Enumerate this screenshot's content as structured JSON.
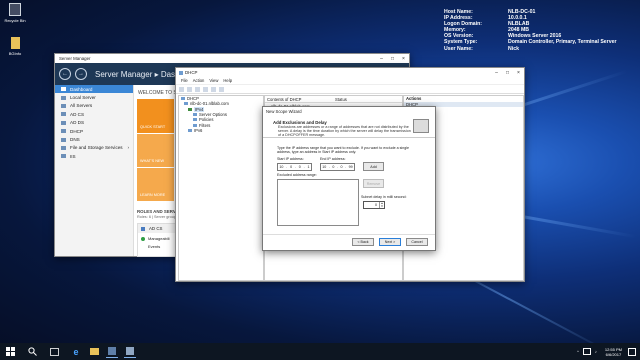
{
  "desktop": {
    "icons": [
      {
        "label": "Recycle Bin"
      },
      {
        "label": "BGInfo"
      }
    ]
  },
  "bginfo": {
    "rows": [
      {
        "key": "Host Name:",
        "value": "NLB-DC-01"
      },
      {
        "key": "IP Address:",
        "value": "10.0.0.1"
      },
      {
        "key": "Logon Domain:",
        "value": "NLBLAB"
      },
      {
        "key": "Memory:",
        "value": "2048 MB"
      },
      {
        "key": "OS Version:",
        "value": "Windows Server 2016"
      },
      {
        "key": "System Type:",
        "value": "Domain Controller, Primary, Terminal Server"
      },
      {
        "key": "User Name:",
        "value": "Nick"
      }
    ]
  },
  "server_manager": {
    "window_title": "Server Manager",
    "header_title": "Server Manager ▸ Dash",
    "sidebar": [
      {
        "label": "Dashboard",
        "selected": true
      },
      {
        "label": "Local Server"
      },
      {
        "label": "All Servers"
      },
      {
        "label": "AD CS"
      },
      {
        "label": "AD DS"
      },
      {
        "label": "DHCP"
      },
      {
        "label": "DNS"
      },
      {
        "label": "File and Storage Services"
      },
      {
        "label": "IIS"
      }
    ],
    "welcome": "WELCOME TO SERVER",
    "tiles": [
      "QUICK START",
      "WHAT'S NEW",
      "LEARN MORE"
    ],
    "roles_heading": "ROLES AND SERVER",
    "roles_sub": "Roles: 6 | Server group",
    "role_card": {
      "title": "AD CS",
      "count": "1",
      "items": [
        "Manageabili",
        "Events"
      ]
    }
  },
  "dhcp": {
    "window_title": "DHCP",
    "menu": [
      "File",
      "Action",
      "View",
      "Help"
    ],
    "tree": [
      {
        "label": "DHCP",
        "indent": 0
      },
      {
        "label": "nlb-dc-01.nlblab.com",
        "indent": 1
      },
      {
        "label": "IPv4",
        "indent": 2,
        "selected": true
      },
      {
        "label": "Server Options",
        "indent": 3
      },
      {
        "label": "Policies",
        "indent": 3
      },
      {
        "label": "Filters",
        "indent": 3
      },
      {
        "label": "IPv6",
        "indent": 2
      }
    ],
    "center_headers": [
      "Contents of DHCP",
      "Status"
    ],
    "center_row": "nlb-dc-01.nlblab.com",
    "actions_header": "Actions",
    "actions_item": "DHCP"
  },
  "wizard": {
    "title": "New Scope Wizard",
    "heading": "Add Exclusions and Delay",
    "description": "Exclusions are addresses or a range of addresses that are not distributed by the server. A delay is the time duration by which the server will delay the transmission of a DHCPOFFER message.",
    "instruction": "Type the IP address range that you want to exclude. If you want to exclude a single address, type an address in Start IP address only.",
    "start_label": "Start IP address:",
    "end_label": "End IP address:",
    "start_ip": [
      "10",
      "0",
      "0",
      "1"
    ],
    "end_ip": [
      "10",
      "0",
      "0",
      "99"
    ],
    "add_label": "Add",
    "excluded_label": "Excluded address range:",
    "remove_label": "Remove",
    "subnet_delay_label": "Subnet delay in milli second:",
    "subnet_delay_value": "0",
    "back_label": "< Back",
    "next_label": "Next >",
    "cancel_label": "Cancel"
  },
  "taskbar": {
    "clock_time": "12:55 PM",
    "clock_date": "6/6/2017"
  }
}
